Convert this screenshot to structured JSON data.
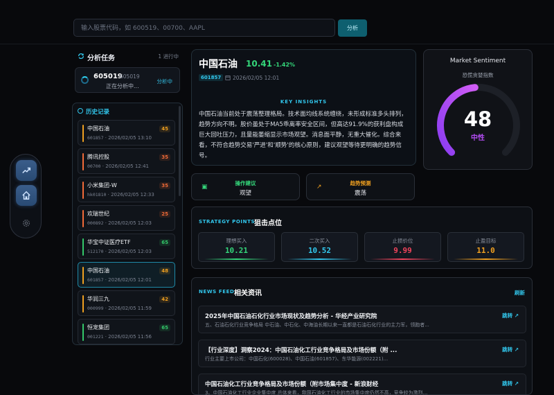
{
  "search": {
    "placeholder": "输入股票代码，如 600519、00700、AAPL",
    "button": "分析"
  },
  "tasks": {
    "title": "分析任务",
    "count": "1 进行中",
    "current": {
      "code": "605019",
      "code_sub": "605019",
      "status": "正在分析中...",
      "badge": "分析中"
    }
  },
  "history": {
    "title": "历史记录",
    "items": [
      {
        "name": "中国石油",
        "code": "601857",
        "date": "2026/02/05 13:10",
        "score": "45",
        "color": "#f0a020",
        "active": false
      },
      {
        "name": "腾讯控股",
        "code": "00700",
        "date": "2026/02/05 12:41",
        "score": "35",
        "color": "#f26b38",
        "active": false
      },
      {
        "name": "小米集团-W",
        "code": "hk01810",
        "date": "2026/02/05 12:33",
        "score": "35",
        "color": "#f26b38",
        "active": false
      },
      {
        "name": "欢瑞世纪",
        "code": "000892",
        "date": "2026/02/05 12:03",
        "score": "25",
        "color": "#f26b38",
        "active": false
      },
      {
        "name": "华宝中证医疗ETF",
        "code": "512170",
        "date": "2026/02/05 12:03",
        "score": "65",
        "color": "#34c96a",
        "active": false
      },
      {
        "name": "中国石油",
        "code": "601857",
        "date": "2026/02/05 12:01",
        "score": "48",
        "color": "#f0a020",
        "active": true
      },
      {
        "name": "华润三九",
        "code": "000999",
        "date": "2026/02/05 11:59",
        "score": "42",
        "color": "#f0a020",
        "active": false
      },
      {
        "name": "恒宠集团",
        "code": "001221",
        "date": "2026/02/05 11:56",
        "score": "65",
        "color": "#34c96a",
        "active": false
      }
    ]
  },
  "stock": {
    "name": "中国石油",
    "price": "10.41",
    "change": "-1.42%",
    "code": "601857",
    "date": "2026/02/05 12:01",
    "insights_title": "KEY INSIGHTS",
    "insights": "中国石油当前处于震荡整理格局。技术面均线系统缠绕，未形成标准多头排列，趋势方向不明。股价虽处于MA5乖离率安全区间，但高达91.9%的获利盘构成巨大回吐压力，且量能萎缩显示市场观望。消息面平静，无重大催化。综合来看，不符合趋势交易'严进'和'顺势'的核心原则，建议观望等待更明确的趋势信号。"
  },
  "sentiment": {
    "title": "Market Sentiment",
    "subtitle": "恐慌贪婪指数",
    "value": "48",
    "fraction": 0.48,
    "label": "中性"
  },
  "advice": {
    "op_title": "操作建议",
    "op_value": "观望",
    "trend_title": "趋势预测",
    "trend_value": "震荡"
  },
  "strategy": {
    "title_en": "STRATEGY POINTS",
    "title_cn": "狙击点位",
    "points": [
      {
        "label": "理想买入",
        "value": "10.21",
        "color": "#34d67a"
      },
      {
        "label": "二次买入",
        "value": "10.52",
        "color": "#32c8ee"
      },
      {
        "label": "止损价位",
        "value": "9.99",
        "color": "#f2445c"
      },
      {
        "label": "止盈目标",
        "value": "11.0",
        "color": "#f0a020"
      }
    ]
  },
  "news": {
    "title_en": "NEWS FEED",
    "title_cn": "相关资讯",
    "refresh": "刷新",
    "jump": "跳转 ↗",
    "items": [
      {
        "title": "2025年中国石油石化行业市场现状及趋势分析 - 华经产业研究院",
        "summary": "五、石油石化行业竞争格局 中石油、中石化、中海油长期以来一直都是石油石化行业的主力军，领跑者..."
      },
      {
        "title": "【行业深度】洞察2024：中国石油化工行业竞争格局及市场份额（附 ...",
        "summary": "行业主要上市公司：中国石化(600028)、中国石油(601857)、东华能源(002221)..."
      },
      {
        "title": "中国石油化工行业竞争格局及市场份额（附市场集中度 - 新浪财经",
        "summary": "3、中国石油化工行业企业集中度 总体来看，我国石油化工行业的市场集中度仍然不高，竞争较为激烈..."
      }
    ]
  }
}
